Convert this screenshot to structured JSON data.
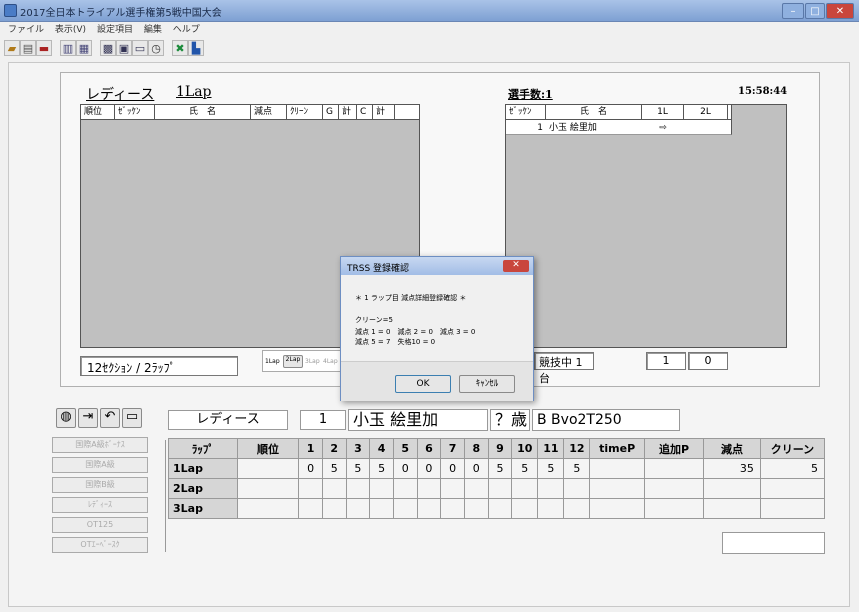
{
  "window": {
    "title": "2017全日本トライアル選手権第5戦中国大会",
    "controls": [
      "–",
      "□",
      "✕"
    ]
  },
  "menu": [
    "ファイル",
    "表示(V)",
    "設定項目",
    "編集",
    "ヘルプ"
  ],
  "toolbar": [
    "open-icon",
    "print-icon",
    "save-icon",
    "copy-icon",
    "paste-icon",
    "grid-icon",
    "print-preview-icon",
    "window-icon",
    "clock-icon",
    "close-icon",
    "chart-icon"
  ],
  "panel": {
    "class_label": "レディース",
    "lap_label": "1Lap",
    "clock": "15:58:44",
    "left_columns": [
      "順位",
      "ｾﾞｯｹﾝ",
      "氏　名",
      "減点",
      "ｸﾘｰﾝ",
      "G",
      "計",
      "C",
      "計"
    ],
    "right_title": "選手数:1",
    "right_columns": [
      "ｾﾞｯｹﾝ",
      "氏　名",
      "1L",
      "2L"
    ],
    "right_row": {
      "bib": "1",
      "name": "小玉 絵里加",
      "l1": "⇨",
      "l2": ""
    },
    "section_info": "12ｾｸｼｮﾝ / 2ﾗｯﾌﾟ",
    "mini_tabs": [
      "1Lap",
      "2Lap",
      "3Lap",
      "4Lap"
    ],
    "status_text": "競技中 1台",
    "count_a": "1",
    "count_b": "0"
  },
  "dialog": {
    "title": "TRSS 登録確認",
    "heading": "＊ 1 ラップ目 減点詳細登録確認 ＊",
    "clean": "クリーン=5",
    "line1": "減点 1 = 0　減点 2 = 0　減点 3 = 0",
    "line2": "減点 5 = 7　失格10 = 0",
    "ok": "OK",
    "cancel": "ｷｬﾝｾﾙ"
  },
  "rider": {
    "class": "レディース",
    "bib": "1",
    "name": "小玉 絵里加",
    "age": "？歳",
    "machine": "B Bvo2T250"
  },
  "side_buttons": [
    "国際A級ﾎﾞｰﾅｽ",
    "国際A級",
    "国際B級",
    "ﾚﾃﾞｨｰｽ",
    "OT125",
    "OTｴｰﾍﾞｰｽｸ"
  ],
  "lap_table": {
    "headers": [
      "ﾗｯﾌﾟ",
      "順位",
      "1",
      "2",
      "3",
      "4",
      "5",
      "6",
      "7",
      "8",
      "9",
      "10",
      "11",
      "12",
      "timeP",
      "追加P",
      "減点",
      "クリーン"
    ],
    "rows": [
      {
        "lap": "1Lap",
        "rank": "",
        "scores": [
          "0",
          "5",
          "5",
          "5",
          "0",
          "0",
          "0",
          "0",
          "5",
          "5",
          "5",
          "5"
        ],
        "timep": "",
        "addp": "",
        "penalty": "35",
        "clean": "5"
      },
      {
        "lap": "2Lap",
        "rank": "",
        "scores": [
          "",
          "",
          "",
          "",
          "",
          "",
          "",
          "",
          "",
          "",
          "",
          ""
        ],
        "timep": "",
        "addp": "",
        "penalty": "",
        "clean": ""
      },
      {
        "lap": "3Lap",
        "rank": "",
        "scores": [
          "",
          "",
          "",
          "",
          "",
          "",
          "",
          "",
          "",
          "",
          "",
          ""
        ],
        "timep": "",
        "addp": "",
        "penalty": "",
        "clean": ""
      }
    ]
  }
}
